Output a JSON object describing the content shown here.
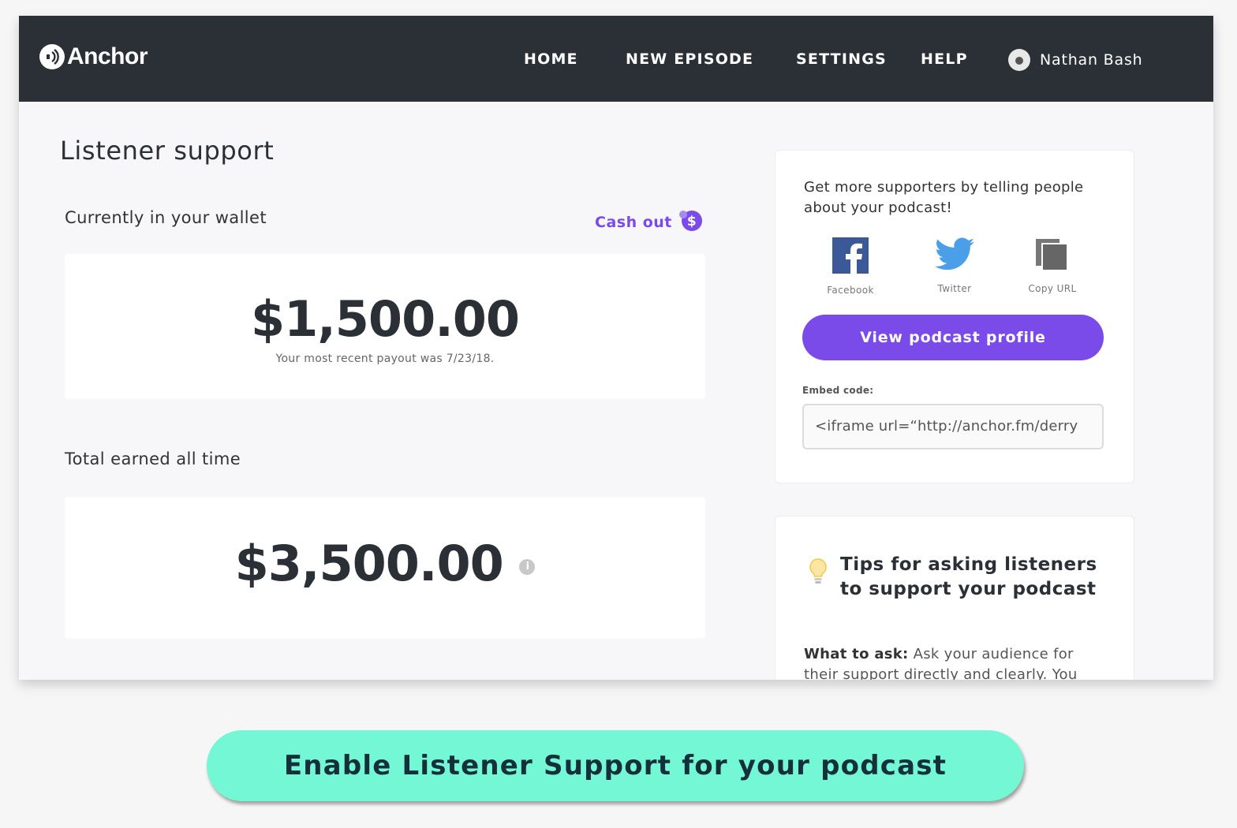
{
  "navbar": {
    "logo_text": "Anchor",
    "items": [
      "HOME",
      "NEW EPISODE",
      "SETTINGS",
      "HELP"
    ],
    "user_name": "Nathan Bash"
  },
  "main": {
    "title": "Listener support",
    "wallet_label": "Currently in your wallet",
    "cashout_label": "Cash out",
    "wallet_amount": "$1,500.00",
    "payout_note": "Your most recent payout was 7/23/18.",
    "total_label": "Total earned all time",
    "total_amount": "$3,500.00"
  },
  "promo": {
    "text": "Get more supporters by telling people about your podcast!",
    "share": [
      {
        "label": "Facebook",
        "icon": "facebook-icon"
      },
      {
        "label": "Twitter",
        "icon": "twitter-icon"
      },
      {
        "label": "Copy URL",
        "icon": "copy-icon"
      }
    ],
    "view_button": "View podcast profile",
    "embed_label": "Embed code:",
    "embed_value": "<iframe url=“http://anchor.fm/derry"
  },
  "tips": {
    "title": "Tips for asking listeners to support your podcast",
    "body_bold": "What to ask:",
    "body_text": "Ask your audience for their support directly and clearly. You"
  },
  "cta": {
    "label": "Enable Listener Support for your podcast"
  },
  "colors": {
    "navbar": "#2b2f36",
    "accent": "#7b4bea",
    "cta": "#74f7d5"
  }
}
